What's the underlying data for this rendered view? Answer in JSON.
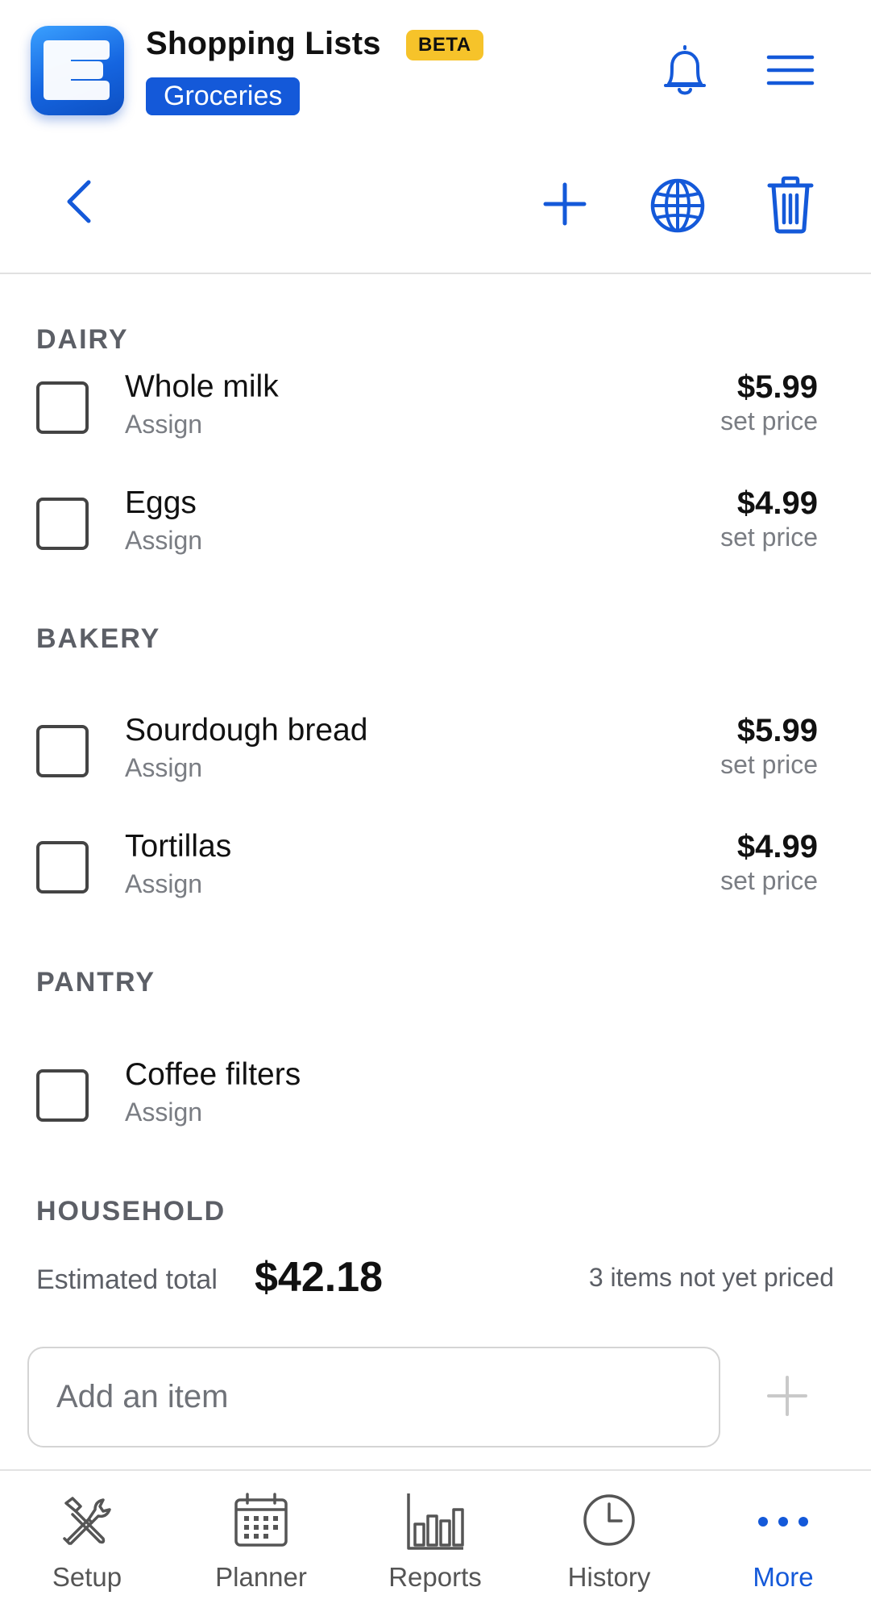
{
  "header": {
    "app_title": "Shopping Lists",
    "badge": "BETA",
    "list_name": "Groceries",
    "logo_letter": "E",
    "icons": [
      "bell-icon",
      "hamburger-menu-icon"
    ]
  },
  "toolbar": {
    "icons": [
      "chevron-left-icon",
      "plus-icon",
      "globe-icon",
      "trash-icon"
    ]
  },
  "sections": [
    {
      "label": "DAIRY",
      "items": [
        {
          "name": "Whole milk",
          "assign": "Assign",
          "price": "$5.99",
          "price_note": "set price",
          "checked": false
        },
        {
          "name": "Eggs",
          "assign": "Assign",
          "price": "$4.99",
          "price_note": "set price",
          "checked": false
        }
      ]
    },
    {
      "label": "BAKERY",
      "items": [
        {
          "name": "Sourdough bread",
          "assign": "Assign",
          "price": "$5.99",
          "price_note": "set price",
          "checked": false
        },
        {
          "name": "Tortillas",
          "assign": "Assign",
          "price": "$4.99",
          "price_note": "set price",
          "checked": false
        }
      ]
    },
    {
      "label": "PANTRY",
      "items": [
        {
          "name": "Coffee filters",
          "assign": "Assign",
          "checked": false
        }
      ]
    },
    {
      "label": "HOUSEHOLD",
      "items": []
    }
  ],
  "summary": {
    "total_label": "Estimated total",
    "total_value": "$42.18",
    "unpriced_note": "3 items not yet priced"
  },
  "add_item": {
    "placeholder": "Add an item",
    "value": ""
  },
  "bottom_nav": [
    {
      "label": "Setup",
      "icon": "tools-icon",
      "active": false
    },
    {
      "label": "Planner",
      "icon": "calendar-icon",
      "active": false
    },
    {
      "label": "Reports",
      "icon": "bar-chart-icon",
      "active": false
    },
    {
      "label": "History",
      "icon": "clock-icon",
      "active": false
    },
    {
      "label": "More",
      "icon": "more-dots-icon",
      "active": true
    }
  ],
  "colors": {
    "accent": "#1459d9",
    "badge": "#f6c32a",
    "muted_text": "#7a7d83",
    "section_label": "#5c5f66"
  }
}
